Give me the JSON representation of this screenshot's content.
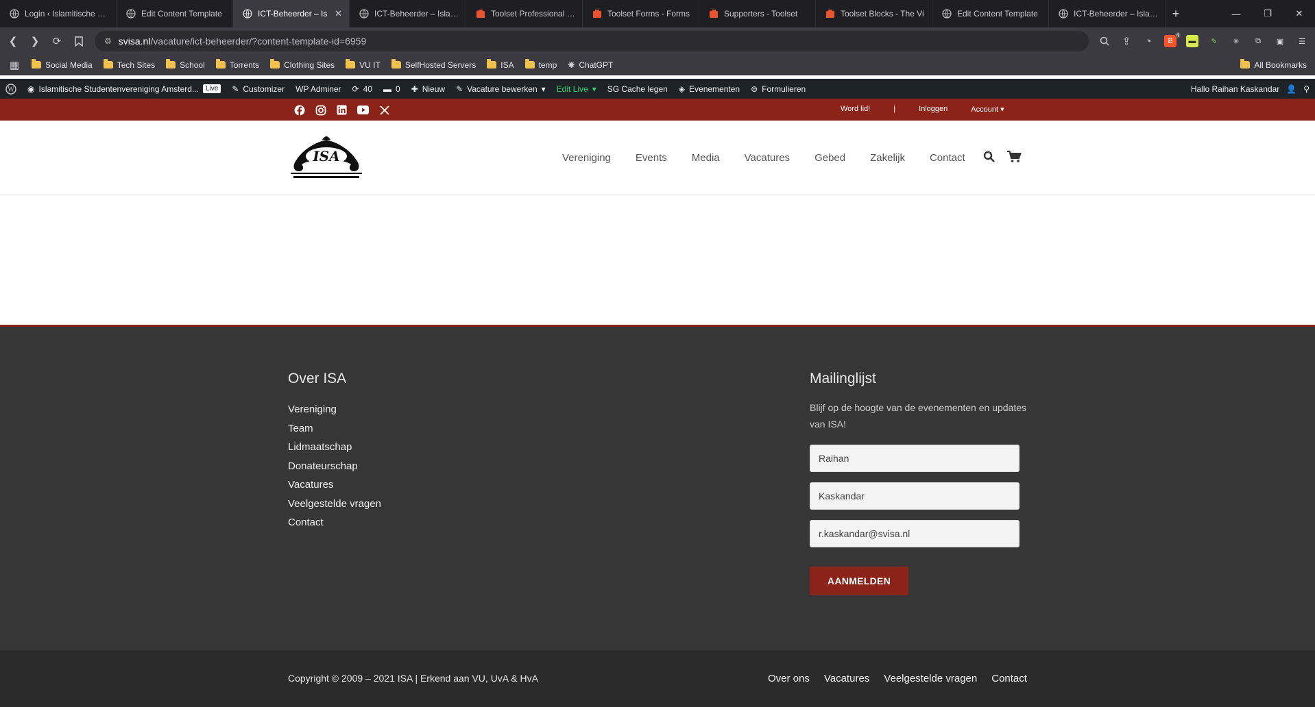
{
  "browser": {
    "tabs": [
      {
        "title": "Login ‹ Islamitische Stu",
        "favicon": "globe-icon",
        "active": false
      },
      {
        "title": "Edit Content Template",
        "favicon": "globe-icon",
        "active": false
      },
      {
        "title": "ICT-Beheerder – Is",
        "favicon": "globe-icon",
        "active": true
      },
      {
        "title": "ICT-Beheerder – Islamit",
        "favicon": "globe-icon",
        "active": false
      },
      {
        "title": "Toolset Professional Su",
        "favicon": "toolset-icon",
        "active": false
      },
      {
        "title": "Toolset Forms - Forms",
        "favicon": "toolset-icon",
        "active": false
      },
      {
        "title": "Supporters - Toolset",
        "favicon": "toolset-icon",
        "active": false
      },
      {
        "title": "Toolset Blocks - The Vi",
        "favicon": "toolset-icon",
        "active": false
      },
      {
        "title": "Edit Content Template",
        "favicon": "globe-icon",
        "active": false
      },
      {
        "title": "ICT-Beheerder – Islamit",
        "favicon": "globe-icon",
        "active": false
      }
    ],
    "url_host": "svisa.nl",
    "url_path": "/vacature/ict-beheerder/?content-template-id=6959",
    "bookmarks": [
      "Social Media",
      "Tech Sites",
      "School",
      "Torrents",
      "Clothing Sites",
      "VU IT",
      "SelfHosted Servers",
      "ISA",
      "temp"
    ],
    "bookmark_chatgpt": "ChatGPT",
    "all_bookmarks": "All Bookmarks",
    "brave_badge": "4"
  },
  "wpbar": {
    "site_name": "Islamitische Studentenvereniging Amsterd...",
    "live": "Live",
    "customizer": "Customizer",
    "wp_adminer": "WP Adminer",
    "updates": "40",
    "comments": "0",
    "new": "Nieuw",
    "edit": "Vacature bewerken",
    "edit_live": "Edit Live",
    "cache": "SG Cache legen",
    "events": "Evenementen",
    "forms": "Formulieren",
    "greeting": "Hallo Raihan Kaskandar"
  },
  "topbar": {
    "social_icons": [
      "facebook-icon",
      "instagram-icon",
      "linkedin-icon",
      "youtube-icon",
      "x-icon"
    ],
    "join": "Word lid!",
    "separator": "|",
    "login": "Inloggen",
    "account": "Account"
  },
  "header": {
    "logo_text": "ISA",
    "nav": [
      "Vereniging",
      "Events",
      "Media",
      "Vacatures",
      "Gebed",
      "Zakelijk",
      "Contact"
    ]
  },
  "footer": {
    "about_title": "Over ISA",
    "about_links": [
      "Vereniging",
      "Team",
      "Lidmaatschap",
      "Donateurschap",
      "Vacatures",
      "Veelgestelde vragen",
      "Contact"
    ],
    "mailing_title": "Mailinglijst",
    "mailing_text": "Blijf op de hoogte van de evenementen en updates van ISA!",
    "first_name": "Raihan",
    "last_name": "Kaskandar",
    "email": "r.kaskandar@svisa.nl",
    "subscribe": "AANMELDEN",
    "copyright": "Copyright © 2009 – 2021 ISA | Erkend aan VU, UvA & HvA",
    "bottom_links": [
      "Over ons",
      "Vacatures",
      "Veelgestelde vragen",
      "Contact"
    ]
  },
  "colors": {
    "brand": "#8b2318",
    "footer_bg": "#363636",
    "bottom_bg": "#2b2b2b",
    "wpbar_bg": "#1d2327"
  }
}
